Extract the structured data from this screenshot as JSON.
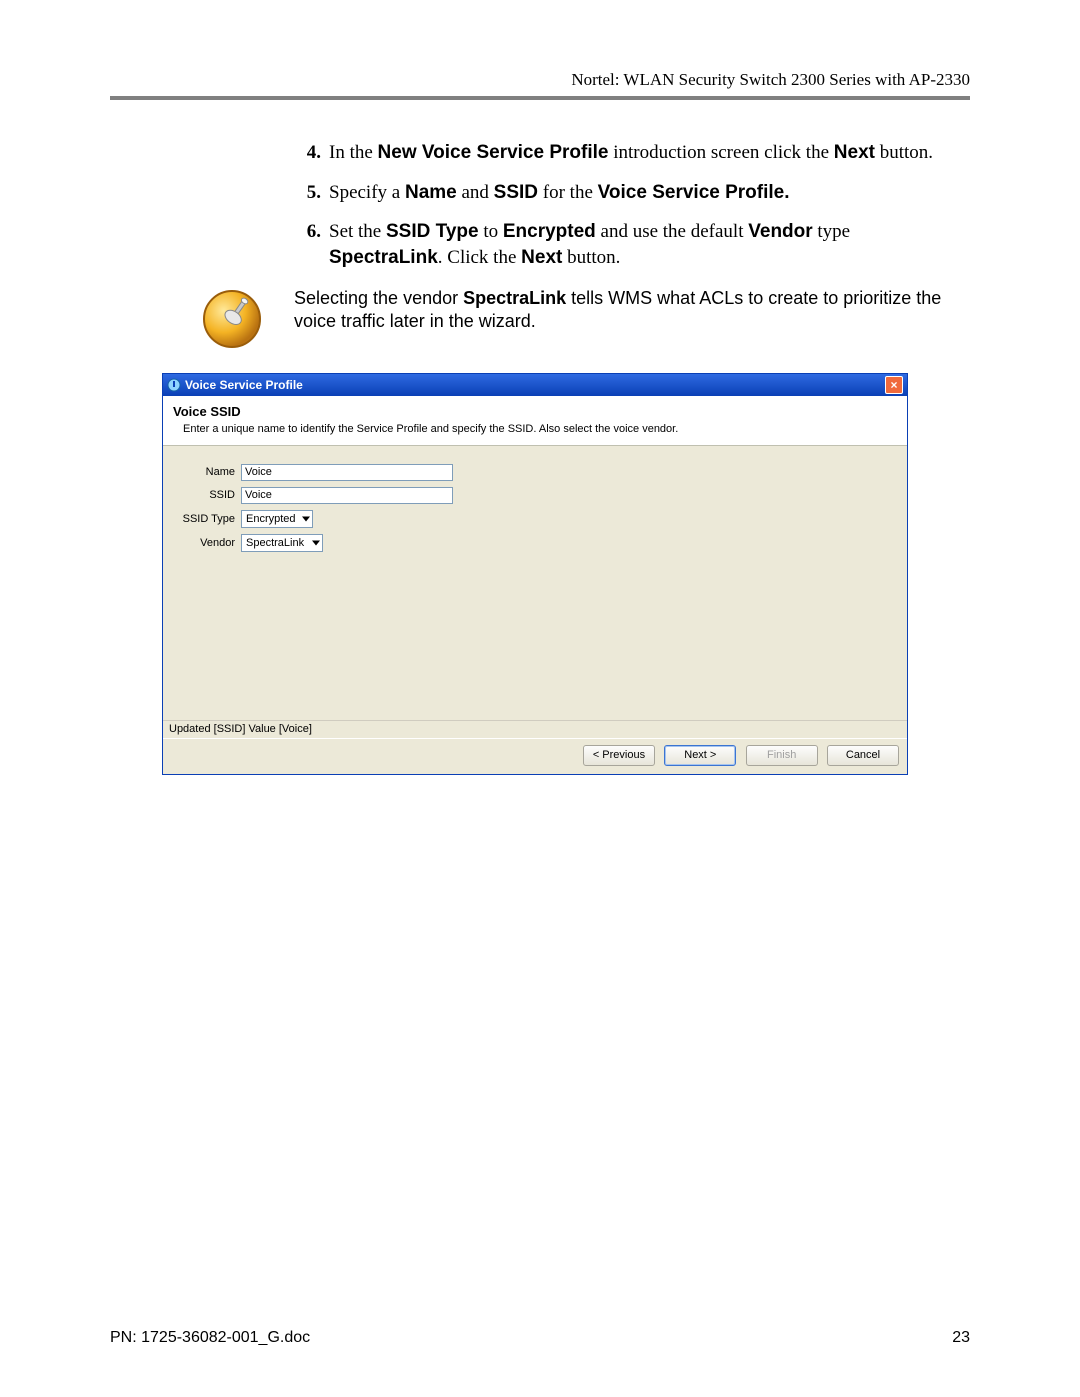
{
  "header": {
    "title": "Nortel: WLAN Security Switch 2300 Series with AP-2330"
  },
  "steps": [
    {
      "num": "4.",
      "html": "In the <b>New Voice Service Profile</b> introduction screen click the <b>Next</b> button."
    },
    {
      "num": "5.",
      "html": "Specify a <b>Name</b> and <b>SSID</b> for the <b>Voice Service Profile.</b>"
    },
    {
      "num": "6.",
      "html": "Set the <b>SSID Type</b> to <b>Encrypted</b> and use the default <b>Vendor</b> type <b>SpectraLink</b>. Click the <b>Next</b> button."
    }
  ],
  "note": {
    "html": "Selecting the vendor <b>SpectraLink</b> tells WMS what ACLs to create to prioritize the voice traffic later in the wizard."
  },
  "dialog": {
    "title": "Voice Service Profile",
    "close_label": "×",
    "heading": "Voice SSID",
    "description": "Enter a unique name to identify the Service Profile and specify the SSID. Also select the voice vendor.",
    "fields": {
      "name_label": "Name",
      "name_value": "Voice",
      "ssid_label": "SSID",
      "ssid_value": "Voice",
      "ssid_type_label": "SSID Type",
      "ssid_type_value": "Encrypted",
      "vendor_label": "Vendor",
      "vendor_value": "SpectraLink"
    },
    "status": "Updated [SSID] Value [Voice]",
    "buttons": {
      "previous": "< Previous",
      "next": "Next >",
      "finish": "Finish",
      "cancel": "Cancel"
    }
  },
  "footer": {
    "pn": "PN: 1725-36082-001_G.doc",
    "page": "23"
  }
}
